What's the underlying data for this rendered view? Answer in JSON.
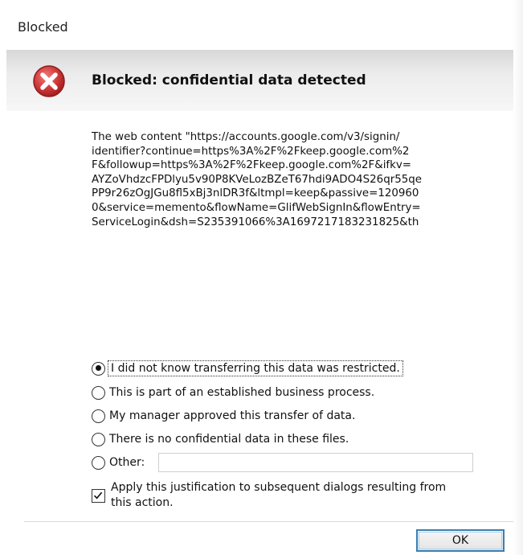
{
  "window": {
    "title": "Blocked"
  },
  "banner": {
    "icon": "error-x-icon",
    "title": "Blocked: confidential data detected"
  },
  "message": {
    "lines": [
      "The web content \"https://accounts.google.com/v3/signin/",
      "identifier?continue=https%3A%2F%2Fkeep.google.com%2",
      "F&followup=https%3A%2F%2Fkeep.google.com%2F&ifkv=",
      "AYZoVhdzcFPDlyu5v90P8KVeLozBZeT67hdi9ADO4S26qr55qe",
      "PP9r26zOgJGu8fl5xBj3nlDR3f&ltmpl=keep&passive=120960",
      "0&service=memento&flowName=GlifWebSignIn&flowEntry=",
      "ServiceLogin&dsh=S235391066%3A1697217183231825&th"
    ]
  },
  "justification": {
    "options": [
      {
        "label": "I did not know transferring this data was restricted.",
        "checked": true
      },
      {
        "label": "This is part of an established business process.",
        "checked": false
      },
      {
        "label": "My manager approved this transfer of data.",
        "checked": false
      },
      {
        "label": "There is no confidential data in these files.",
        "checked": false
      },
      {
        "label": "Other:",
        "checked": false
      }
    ],
    "other_value": "",
    "apply_checkbox": {
      "label": "Apply this justification to subsequent dialogs resulting from this action.",
      "checked": true
    }
  },
  "buttons": {
    "ok_label": "OK"
  },
  "colors": {
    "ok_border": "#3c7fb1",
    "error_red": "#d03a3a"
  }
}
